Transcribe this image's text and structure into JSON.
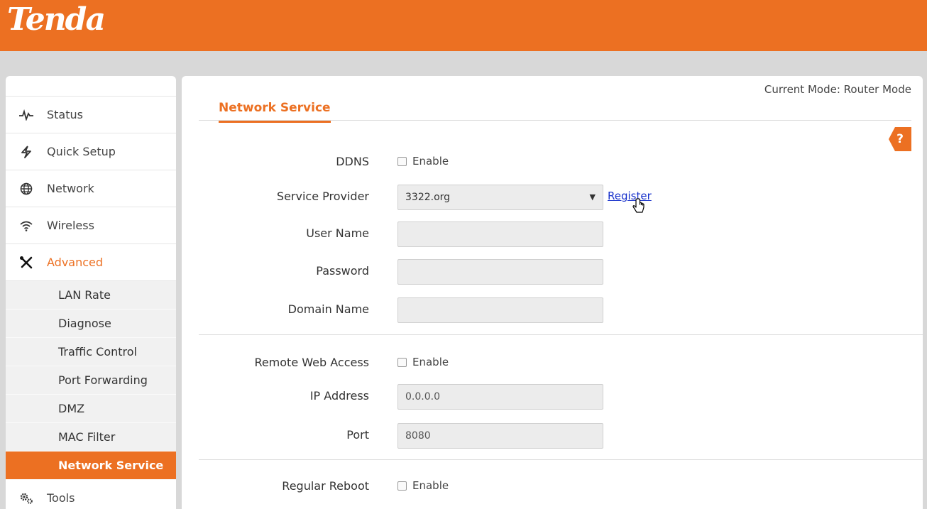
{
  "brand": {
    "logo_text": "Tenda",
    "accent_color": "#ec7022"
  },
  "header": {
    "current_mode": "Current Mode: Router Mode"
  },
  "sidebar": {
    "items": [
      {
        "label": "Status",
        "icon": "pulse-icon"
      },
      {
        "label": "Quick Setup",
        "icon": "lightning-icon"
      },
      {
        "label": "Network",
        "icon": "globe-icon"
      },
      {
        "label": "Wireless",
        "icon": "wifi-icon"
      },
      {
        "label": "Advanced",
        "icon": "tools-icon",
        "active": true
      },
      {
        "label": "Tools",
        "icon": "gears-icon"
      }
    ],
    "advanced_sub": [
      {
        "label": "LAN Rate"
      },
      {
        "label": "Diagnose"
      },
      {
        "label": "Traffic Control"
      },
      {
        "label": "Port Forwarding"
      },
      {
        "label": "DMZ"
      },
      {
        "label": "MAC Filter"
      },
      {
        "label": "Network Service",
        "active": true
      }
    ]
  },
  "page": {
    "title": "Network Service",
    "help": "?"
  },
  "ddns": {
    "label": "DDNS",
    "enable_label": "Enable",
    "enabled": false,
    "provider_label": "Service Provider",
    "provider_value": "3322.org",
    "register_link": "Register",
    "username_label": "User Name",
    "username_value": "",
    "password_label": "Password",
    "password_value": "",
    "domain_label": "Domain Name",
    "domain_value": ""
  },
  "remote": {
    "label": "Remote Web Access",
    "enable_label": "Enable",
    "enabled": false,
    "ip_label": "IP Address",
    "ip_value": "0.0.0.0",
    "port_label": "Port",
    "port_value": "8080"
  },
  "reboot": {
    "label": "Regular Reboot",
    "enable_label": "Enable",
    "enabled": false
  }
}
